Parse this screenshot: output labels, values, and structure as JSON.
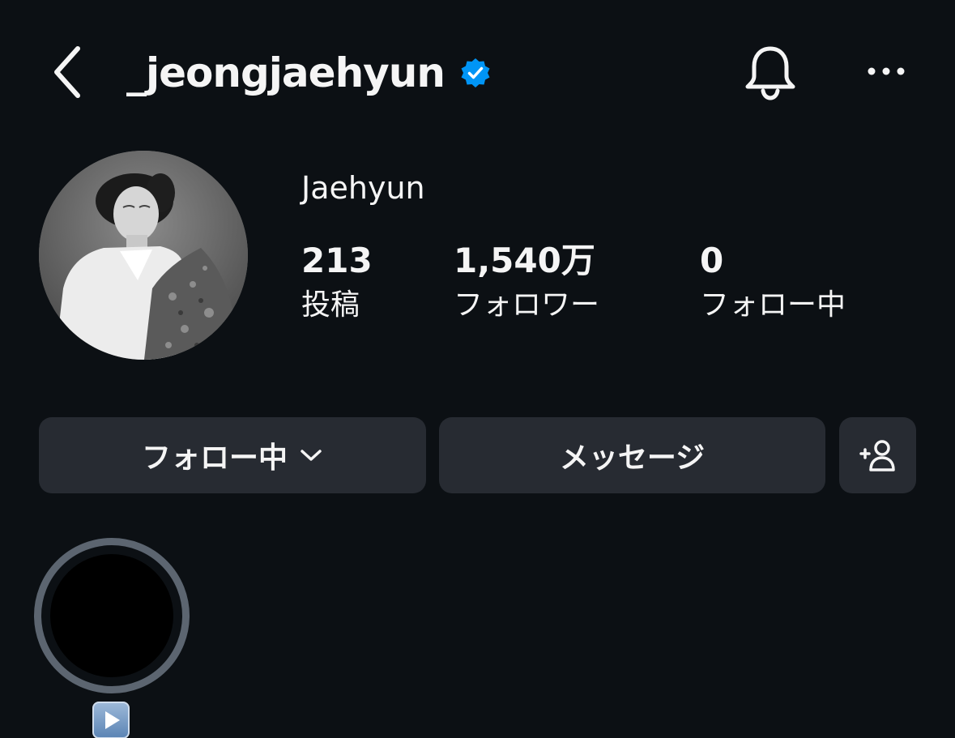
{
  "header": {
    "username": "_jeongjaehyun",
    "verified": true,
    "back_icon": "chevron-left-icon",
    "bell_icon": "bell-icon",
    "more_icon": "more-horizontal-icon"
  },
  "profile": {
    "display_name": "Jaehyun",
    "avatar_icon": "avatar-photo",
    "stats": [
      {
        "value": "213",
        "label": "投稿"
      },
      {
        "value": "1,540万",
        "label": "フォロワー"
      },
      {
        "value": "0",
        "label": "フォロー中"
      }
    ]
  },
  "actions": {
    "following_label": "フォロー中",
    "message_label": "メッセージ",
    "add_user_icon": "add-user-icon"
  },
  "highlights": [
    {
      "label_icon": "play-emoji-icon"
    }
  ],
  "colors": {
    "background": "#0c1014",
    "button": "#272b32",
    "verified": "#0095f6",
    "ring": "#5c6570"
  }
}
